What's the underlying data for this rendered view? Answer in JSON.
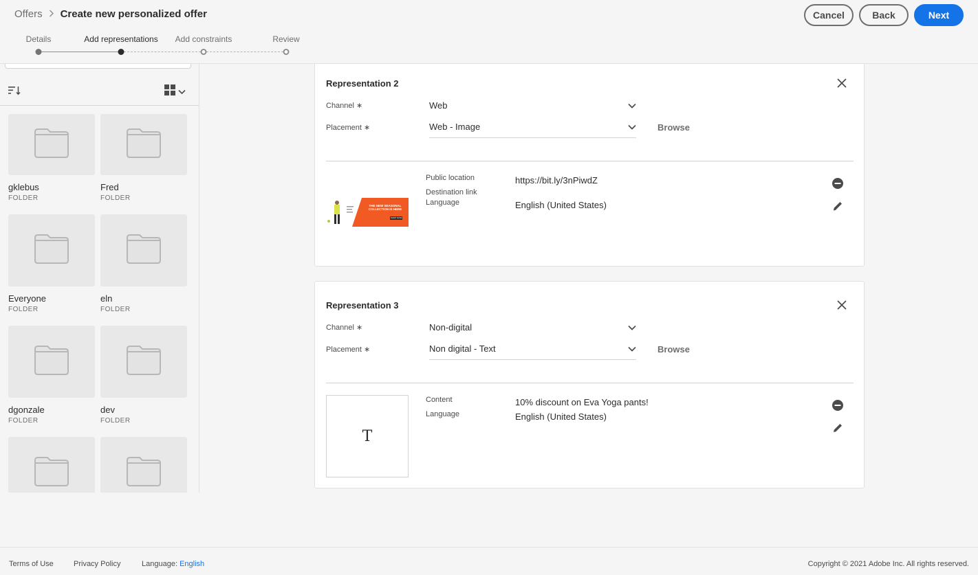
{
  "header": {
    "breadcrumb_root": "Offers",
    "breadcrumb_current": "Create new personalized offer",
    "cancel_label": "Cancel",
    "back_label": "Back",
    "next_label": "Next"
  },
  "stepper": {
    "steps": [
      {
        "label": "Details",
        "state": "done"
      },
      {
        "label": "Add representations",
        "state": "current"
      },
      {
        "label": "Add constraints",
        "state": "todo"
      },
      {
        "label": "Review",
        "state": "todo"
      }
    ]
  },
  "left_panel": {
    "sort_icon": "sort-icon",
    "view_icon": "grid-view-icon",
    "folders": [
      {
        "name": "gklebus",
        "type": "FOLDER"
      },
      {
        "name": "Fred",
        "type": "FOLDER"
      },
      {
        "name": "Everyone",
        "type": "FOLDER"
      },
      {
        "name": "eln",
        "type": "FOLDER"
      },
      {
        "name": "dgonzale",
        "type": "FOLDER"
      },
      {
        "name": "dev",
        "type": "FOLDER"
      },
      {
        "name": "",
        "type": ""
      },
      {
        "name": "",
        "type": ""
      }
    ]
  },
  "representations": [
    {
      "title": "Representation 2",
      "channel_label": "Channel",
      "channel_value": "Web",
      "placement_label": "Placement",
      "placement_value": "Web - Image",
      "browse_label": "Browse",
      "meta": [
        {
          "label": "Public location",
          "value": "https://bit.ly/3nPiwdZ"
        },
        {
          "label": "Destination link",
          "value": ""
        },
        {
          "label": "Language",
          "value": "English (United States)"
        }
      ],
      "banner_text": "THE NEW SEASONAL COLLECTION IS HERE",
      "banner_button": "SHOP NOW"
    },
    {
      "title": "Representation 3",
      "channel_label": "Channel",
      "channel_value": "Non-digital",
      "placement_label": "Placement",
      "placement_value": "Non digital - Text",
      "browse_label": "Browse",
      "meta": [
        {
          "label": "Content",
          "value": "10% discount on Eva Yoga pants!"
        },
        {
          "label": "Language",
          "value": "English (United States)"
        }
      ],
      "thumb_glyph": "T"
    }
  ],
  "footer": {
    "terms": "Terms of Use",
    "privacy": "Privacy Policy",
    "language_label": "Language:",
    "language_value": "English",
    "copyright": "Copyright ©  2021 Adobe Inc.  All rights reserved."
  },
  "colors": {
    "accent": "#1473e6",
    "banner_orange": "#f25a24",
    "background": "#f5f5f5"
  }
}
